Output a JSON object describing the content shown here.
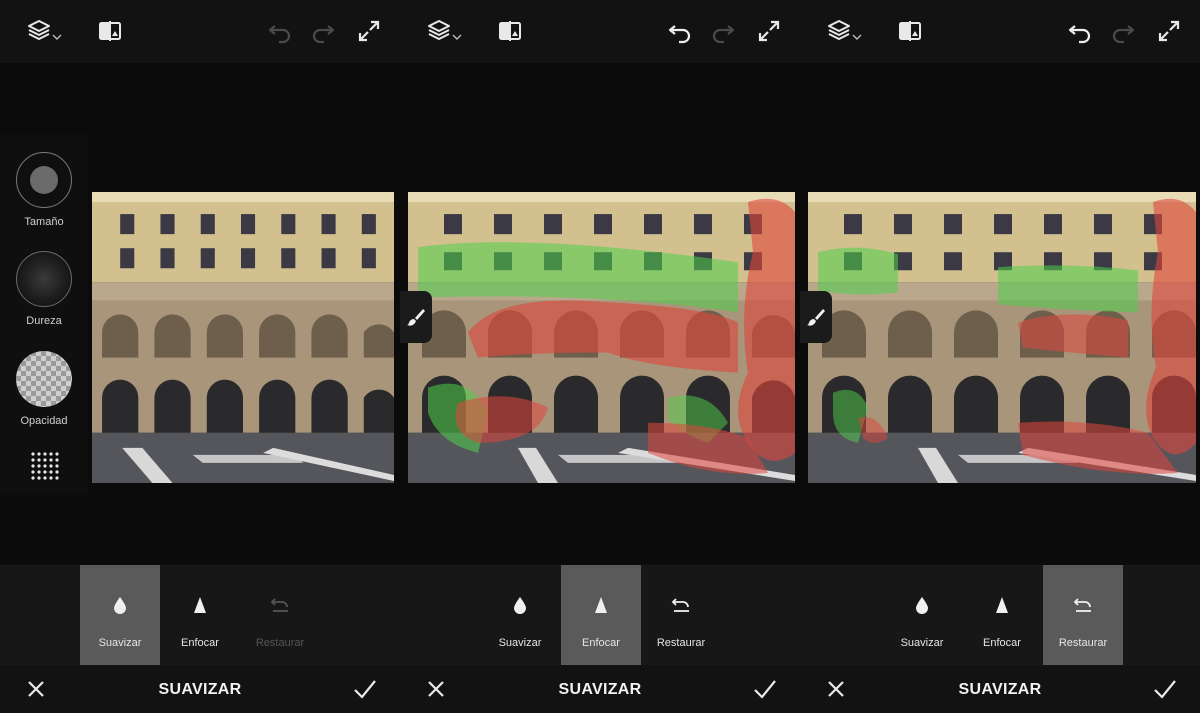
{
  "panels": [
    {
      "top_bar": {
        "icons": [
          "layers-icon",
          "compare-icon",
          "undo-icon",
          "redo-icon",
          "expand-icon"
        ],
        "undo_enabled": false,
        "redo_enabled": false
      },
      "sidebar": {
        "size_label": "Tamaño",
        "hardness_label": "Dureza",
        "opacity_label": "Opacidad"
      },
      "tools": [
        {
          "label": "Suavizar",
          "icon": "droplet-icon",
          "active": true,
          "disabled": false
        },
        {
          "label": "Enfocar",
          "icon": "triangle-icon",
          "active": false,
          "disabled": false
        },
        {
          "label": "Restaurar",
          "icon": "restore-icon",
          "active": false,
          "disabled": true
        }
      ],
      "bottom_bar": {
        "title": "SUAVIZAR"
      }
    },
    {
      "top_bar": {
        "icons": [
          "layers-icon",
          "compare-icon",
          "undo-icon",
          "redo-icon",
          "expand-icon"
        ],
        "undo_enabled": true,
        "redo_enabled": false
      },
      "tools": [
        {
          "label": "Suavizar",
          "icon": "droplet-icon",
          "active": false,
          "disabled": false
        },
        {
          "label": "Enfocar",
          "icon": "triangle-icon",
          "active": true,
          "disabled": false
        },
        {
          "label": "Restaurar",
          "icon": "restore-icon",
          "active": false,
          "disabled": false
        }
      ],
      "bottom_bar": {
        "title": "SUAVIZAR"
      }
    },
    {
      "top_bar": {
        "icons": [
          "layers-icon",
          "compare-icon",
          "undo-icon",
          "redo-icon",
          "expand-icon"
        ],
        "undo_enabled": true,
        "redo_enabled": false
      },
      "tools": [
        {
          "label": "Suavizar",
          "icon": "droplet-icon",
          "active": false,
          "disabled": false
        },
        {
          "label": "Enfocar",
          "icon": "triangle-icon",
          "active": false,
          "disabled": false
        },
        {
          "label": "Restaurar",
          "icon": "restore-icon",
          "active": true,
          "disabled": false
        }
      ],
      "bottom_bar": {
        "title": "SUAVIZAR"
      }
    }
  ],
  "colors": {
    "smooth_overlay": "#e0463c",
    "sharpen_overlay": "#4fd04a",
    "active_tool_bg": "#5a5a5a"
  }
}
